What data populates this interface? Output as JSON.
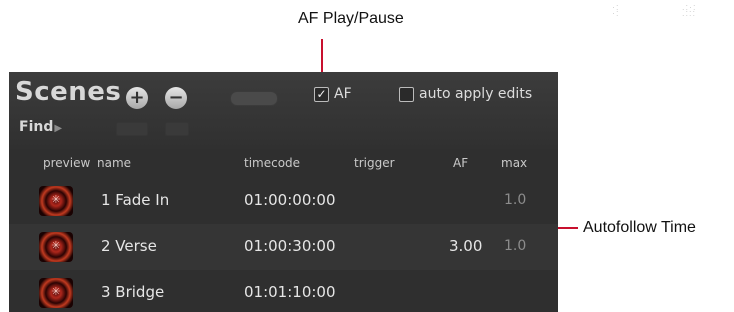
{
  "callouts": {
    "af_play_pause": "AF Play/Pause",
    "autofollow_time": "Autofollow Time"
  },
  "colors": {
    "leader_line": "#c8102e",
    "panel_bg": "#2f2f2f"
  },
  "panel": {
    "title": "Scenes",
    "add_icon": "plus-circle-icon",
    "remove_icon": "minus-circle-icon",
    "af_checkbox": {
      "label": "AF",
      "checked": true,
      "mark": "✓"
    },
    "auto_apply_checkbox": {
      "label": "auto apply edits",
      "checked": false,
      "mark": ""
    },
    "find_label": "Find",
    "find_arrow": "▶"
  },
  "columns": {
    "preview": "preview",
    "name": "name",
    "timecode": "timecode",
    "trigger": "trigger",
    "af": "AF",
    "max": "max"
  },
  "scenes": [
    {
      "name": "1 Fade In",
      "timecode": "01:00:00:00",
      "trigger": "",
      "af": "",
      "max": "1.0"
    },
    {
      "name": "2 Verse",
      "timecode": "01:00:30:00",
      "trigger": "",
      "af": "3.00",
      "max": "1.0"
    },
    {
      "name": "3 Bridge",
      "timecode": "01:01:10:00",
      "trigger": "",
      "af": "",
      "max": ""
    }
  ]
}
